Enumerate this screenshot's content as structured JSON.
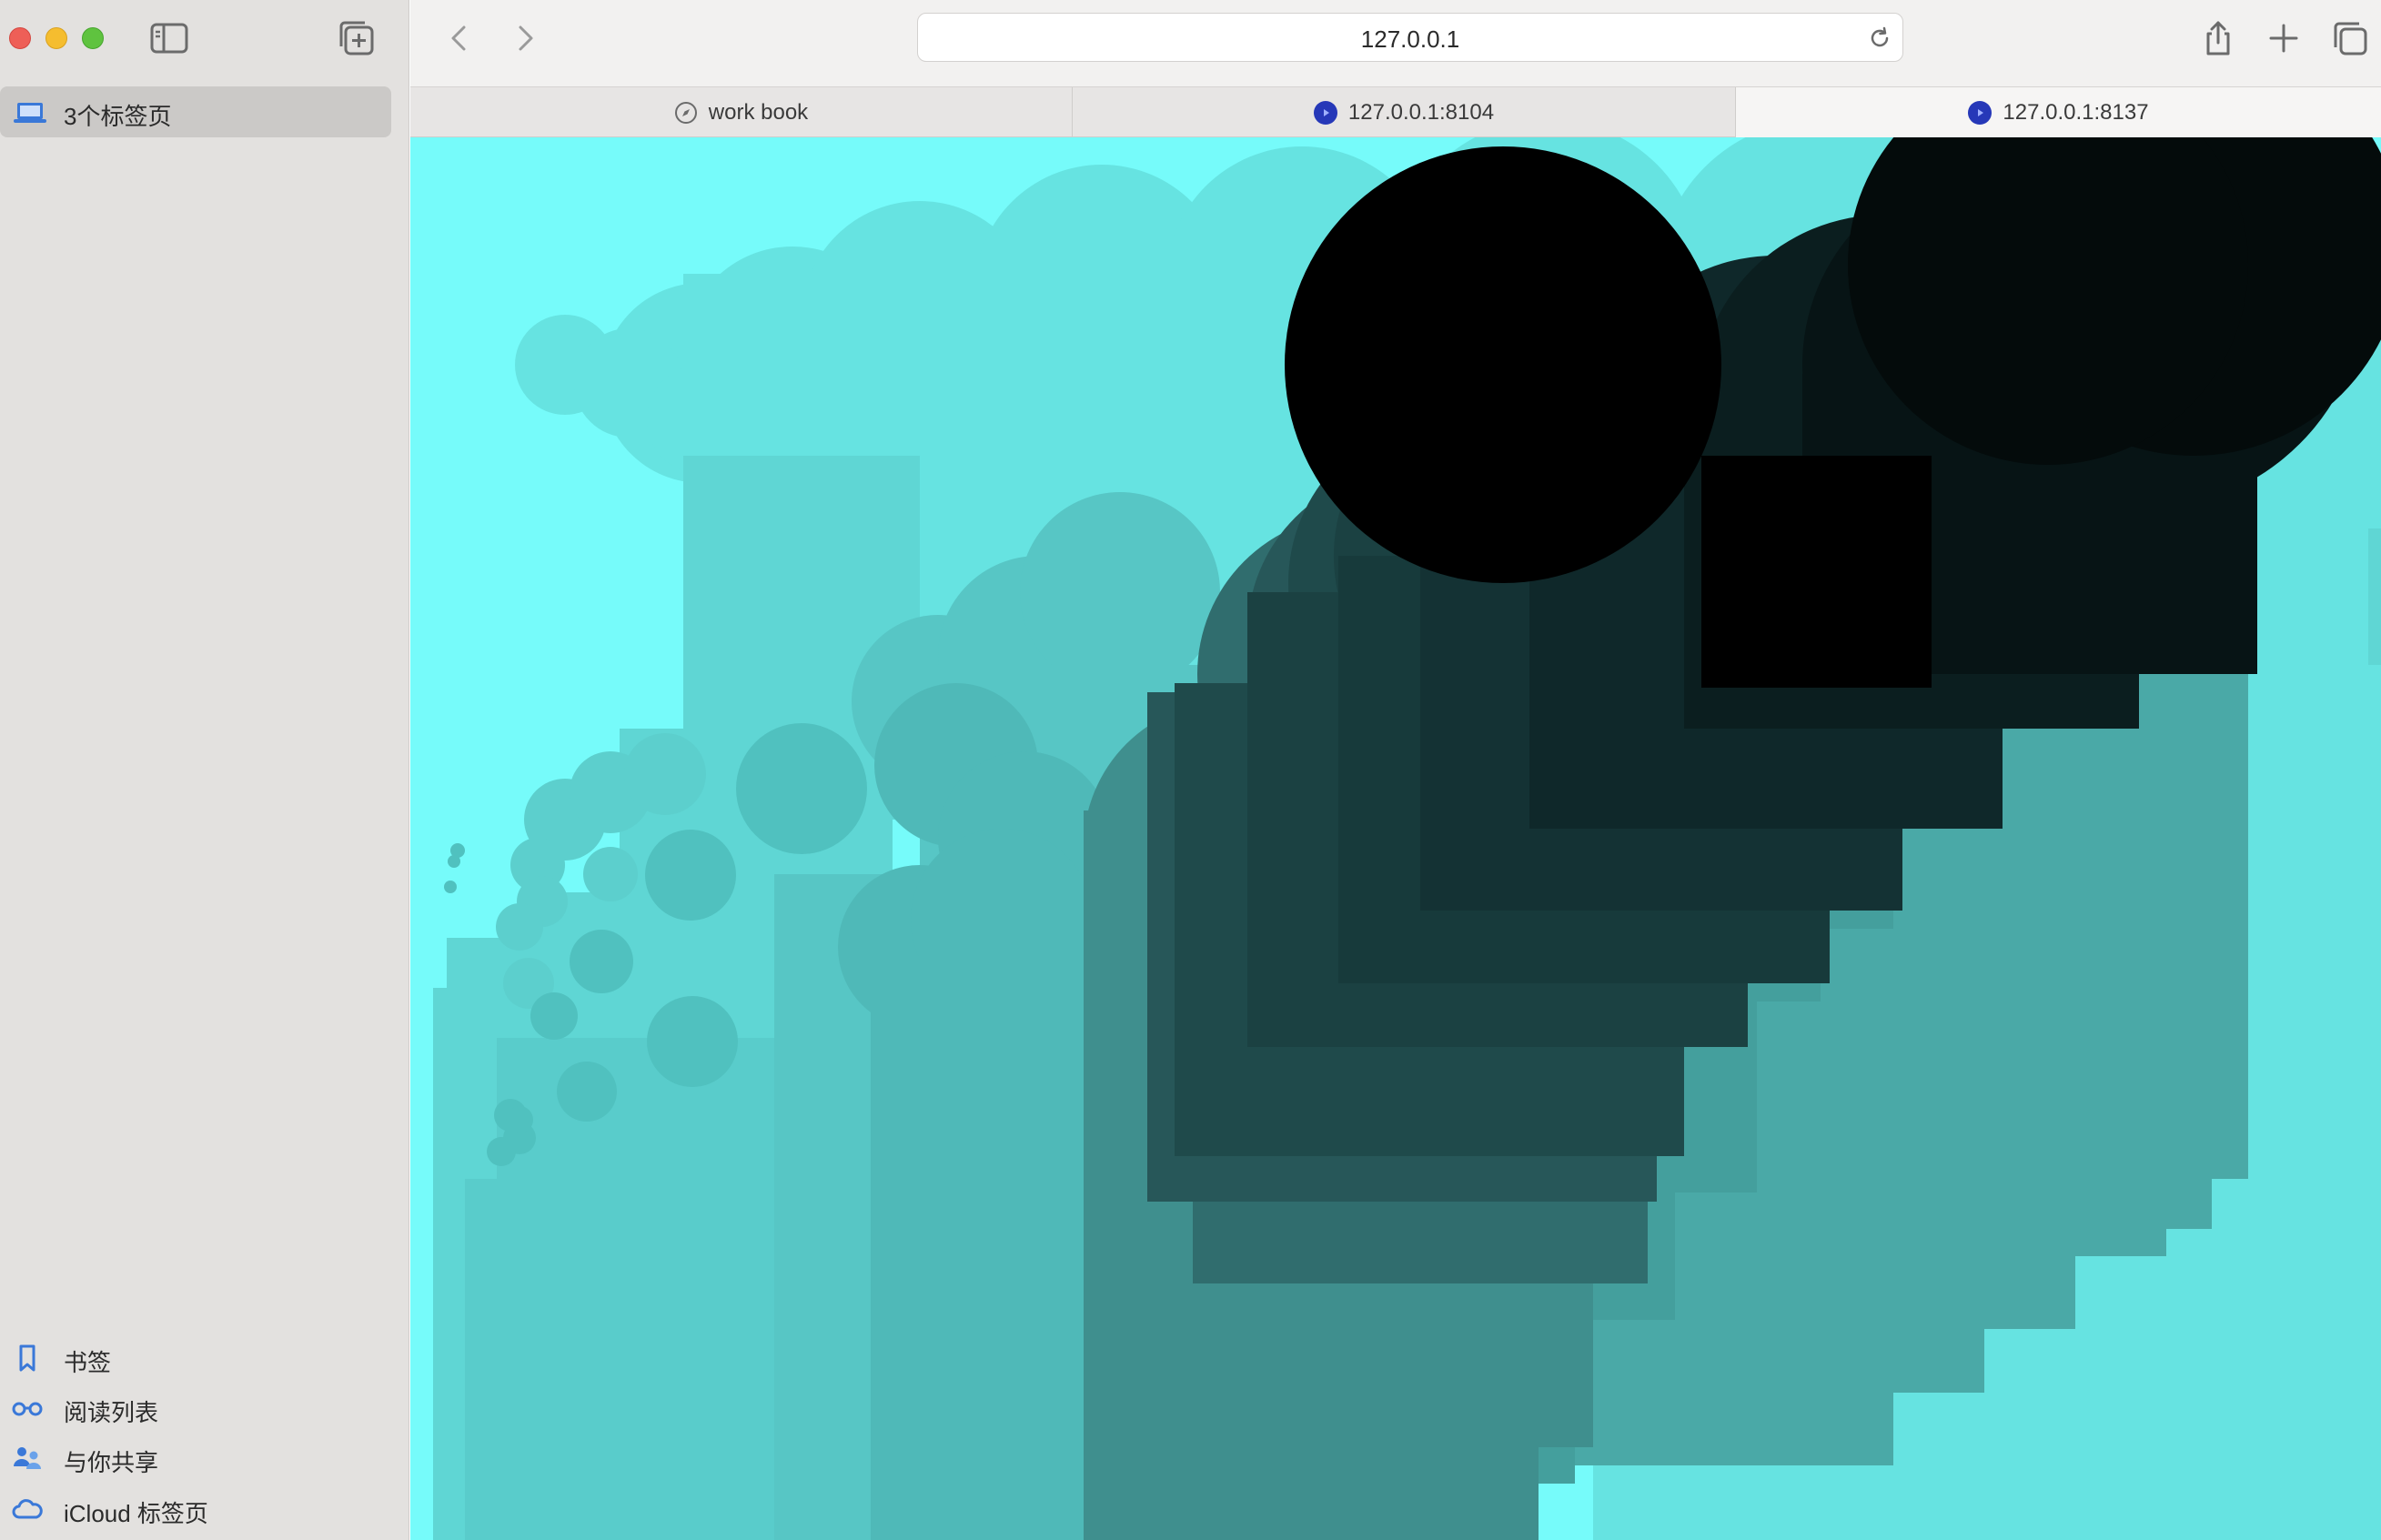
{
  "sidebar": {
    "tab_group": "3个标签页",
    "items": [
      {
        "label": "书签",
        "icon": "bookmark-icon"
      },
      {
        "label": "阅读列表",
        "icon": "reading-list-icon"
      },
      {
        "label": "与你共享",
        "icon": "shared-with-you-icon"
      },
      {
        "label": "iCloud 标签页",
        "icon": "icloud-icon"
      }
    ]
  },
  "toolbar": {
    "url": "127.0.0.1"
  },
  "tabs": [
    {
      "label": "work book",
      "icon": "compass-icon",
      "active": false
    },
    {
      "label": "127.0.0.1:8104",
      "icon": "site-favicon",
      "active": false
    },
    {
      "label": "127.0.0.1:8137",
      "icon": "site-favicon",
      "active": true
    }
  ],
  "colors": {
    "canvas_background": "#76fbfa",
    "favicon": "#2638b8",
    "accent_icon": "#3a78d8"
  }
}
